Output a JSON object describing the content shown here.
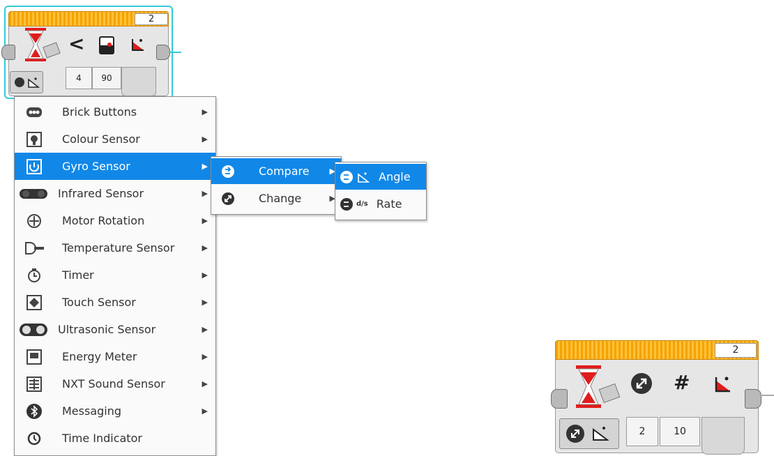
{
  "block_top": {
    "port": "2",
    "params": [
      "4",
      "90"
    ],
    "compare_symbol": "<"
  },
  "block_bottom": {
    "port": "2",
    "params": [
      "2",
      "10"
    ],
    "change_symbol": "#"
  },
  "menu": {
    "items": [
      {
        "label": "Brick Buttons",
        "icon": "brick-buttons-icon"
      },
      {
        "label": "Colour Sensor",
        "icon": "colour-sensor-icon"
      },
      {
        "label": "Gyro Sensor",
        "icon": "gyro-sensor-icon",
        "selected": true
      },
      {
        "label": "Infrared Sensor",
        "icon": "infrared-sensor-icon"
      },
      {
        "label": "Motor Rotation",
        "icon": "motor-rotation-icon"
      },
      {
        "label": "Temperature Sensor",
        "icon": "temperature-sensor-icon"
      },
      {
        "label": "Timer",
        "icon": "timer-icon"
      },
      {
        "label": "Touch Sensor",
        "icon": "touch-sensor-icon"
      },
      {
        "label": "Ultrasonic Sensor",
        "icon": "ultrasonic-sensor-icon"
      },
      {
        "label": "Energy Meter",
        "icon": "energy-meter-icon"
      },
      {
        "label": "NXT Sound Sensor",
        "icon": "nxt-sound-sensor-icon"
      },
      {
        "label": "Messaging",
        "icon": "bluetooth-icon"
      },
      {
        "label": "Time Indicator",
        "icon": "time-indicator-icon"
      }
    ]
  },
  "submenu": {
    "items": [
      {
        "label": "Compare",
        "icon": "compare-icon",
        "selected": true
      },
      {
        "label": "Change",
        "icon": "change-icon"
      }
    ]
  },
  "submenu2": {
    "items": [
      {
        "label": "Angle",
        "icon": "angle-icon",
        "selected": true
      },
      {
        "label": "Rate",
        "icon": "rate-icon",
        "sub": "d/s"
      }
    ]
  },
  "colors": {
    "selection": "#1188e8",
    "accent_top": "#f5a300",
    "timer_red": "#e01c1c",
    "cyan_outline": "#35c9d6"
  }
}
